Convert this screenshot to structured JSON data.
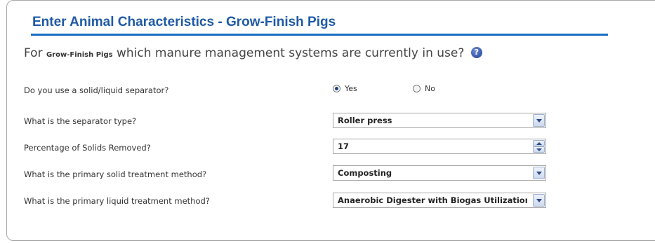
{
  "header": {
    "title": "Enter Animal Characteristics - Grow-Finish Pigs"
  },
  "question": {
    "prefix": "For ",
    "animal": "Grow-Finish Pigs",
    "suffix": " which manure management systems are currently in use?",
    "help_icon": "help-question-icon",
    "help_glyph": "?"
  },
  "form": {
    "separator": {
      "label": "Do you use a solid/liquid separator?",
      "options": [
        {
          "label": "Yes",
          "checked": true
        },
        {
          "label": "No",
          "checked": false
        }
      ]
    },
    "separator_type": {
      "label": "What is the separator type?",
      "value": "Roller press"
    },
    "solids_removed": {
      "label": "Percentage of Solids Removed?",
      "value": "17"
    },
    "solid_treatment": {
      "label": "What is the primary solid treatment method?",
      "value": "Composting"
    },
    "liquid_treatment": {
      "label": "What is the primary liquid treatment method?",
      "value": "Anaerobic Digester with Biogas Utilization o"
    }
  },
  "colors": {
    "title": "#1f5aa6",
    "rule": "#1a6ec0",
    "border": "#a9a9a9"
  }
}
